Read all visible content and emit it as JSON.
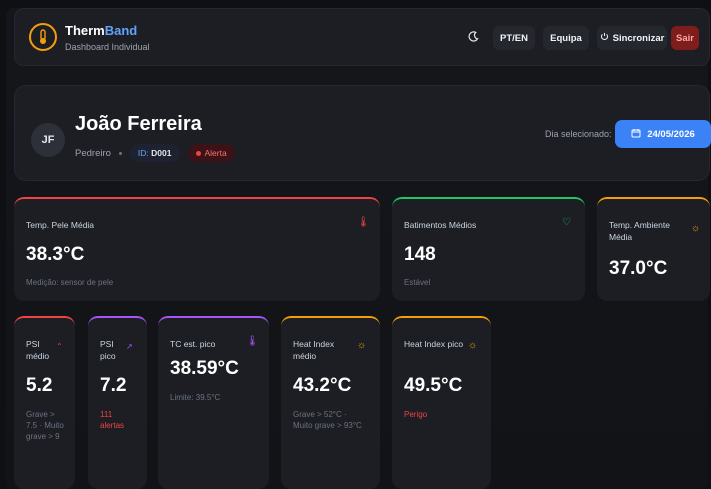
{
  "header": {
    "brand_part1": "Therm",
    "brand_part2": "Band",
    "subtitle": "Dashboard Individual",
    "lang_label": "PT/EN",
    "team_label": "Equipa",
    "sync_label": "Sincronizar",
    "logout_label": "Sair",
    "icons": [
      "thermometer-icon",
      "moon-icon",
      "sync-icon"
    ]
  },
  "profile": {
    "initials": "JF",
    "name": "João Ferreira",
    "role": "Pedreiro",
    "id_label": "ID:",
    "id_value": "D001",
    "status": "Alerta",
    "date_label": "Dia selecionado:",
    "date_value": "24/05/2026"
  },
  "cards": {
    "skin": {
      "title": "Temp. Pele Média",
      "value": "38.3°C",
      "sub": "Medição: sensor de pele",
      "accent": "#ef4444"
    },
    "heart": {
      "title": "Batimentos Médios",
      "value": "148",
      "sub": "Estável",
      "accent": "#22c55e"
    },
    "ambient": {
      "title": "Temp. Ambiente Média",
      "value": "37.0°C",
      "accent": "#f59e0b"
    },
    "psi_avg": {
      "title": "PSI médio",
      "value": "5.2",
      "sub": "Grave > 7.5 · Muito grave > 9",
      "accent": "#ef4444"
    },
    "psi_peak": {
      "title": "PSI pico",
      "value": "7.2",
      "sub": "111 alertas",
      "accent": "#a855f7"
    },
    "tc": {
      "title": "TC est. pico",
      "value": "38.59°C",
      "sub": "Limite: 39.5°C",
      "accent": "#a855f7"
    },
    "hi_avg": {
      "title": "Heat Index médio",
      "value": "43.2°C",
      "sub": "Grave > 52°C · Muito grave > 93°C",
      "accent": "#f59e0b"
    },
    "hi_peak": {
      "title": "Heat Index pico",
      "value": "49.5°C",
      "sub": "Perigo",
      "accent": "#f59e0b"
    }
  }
}
